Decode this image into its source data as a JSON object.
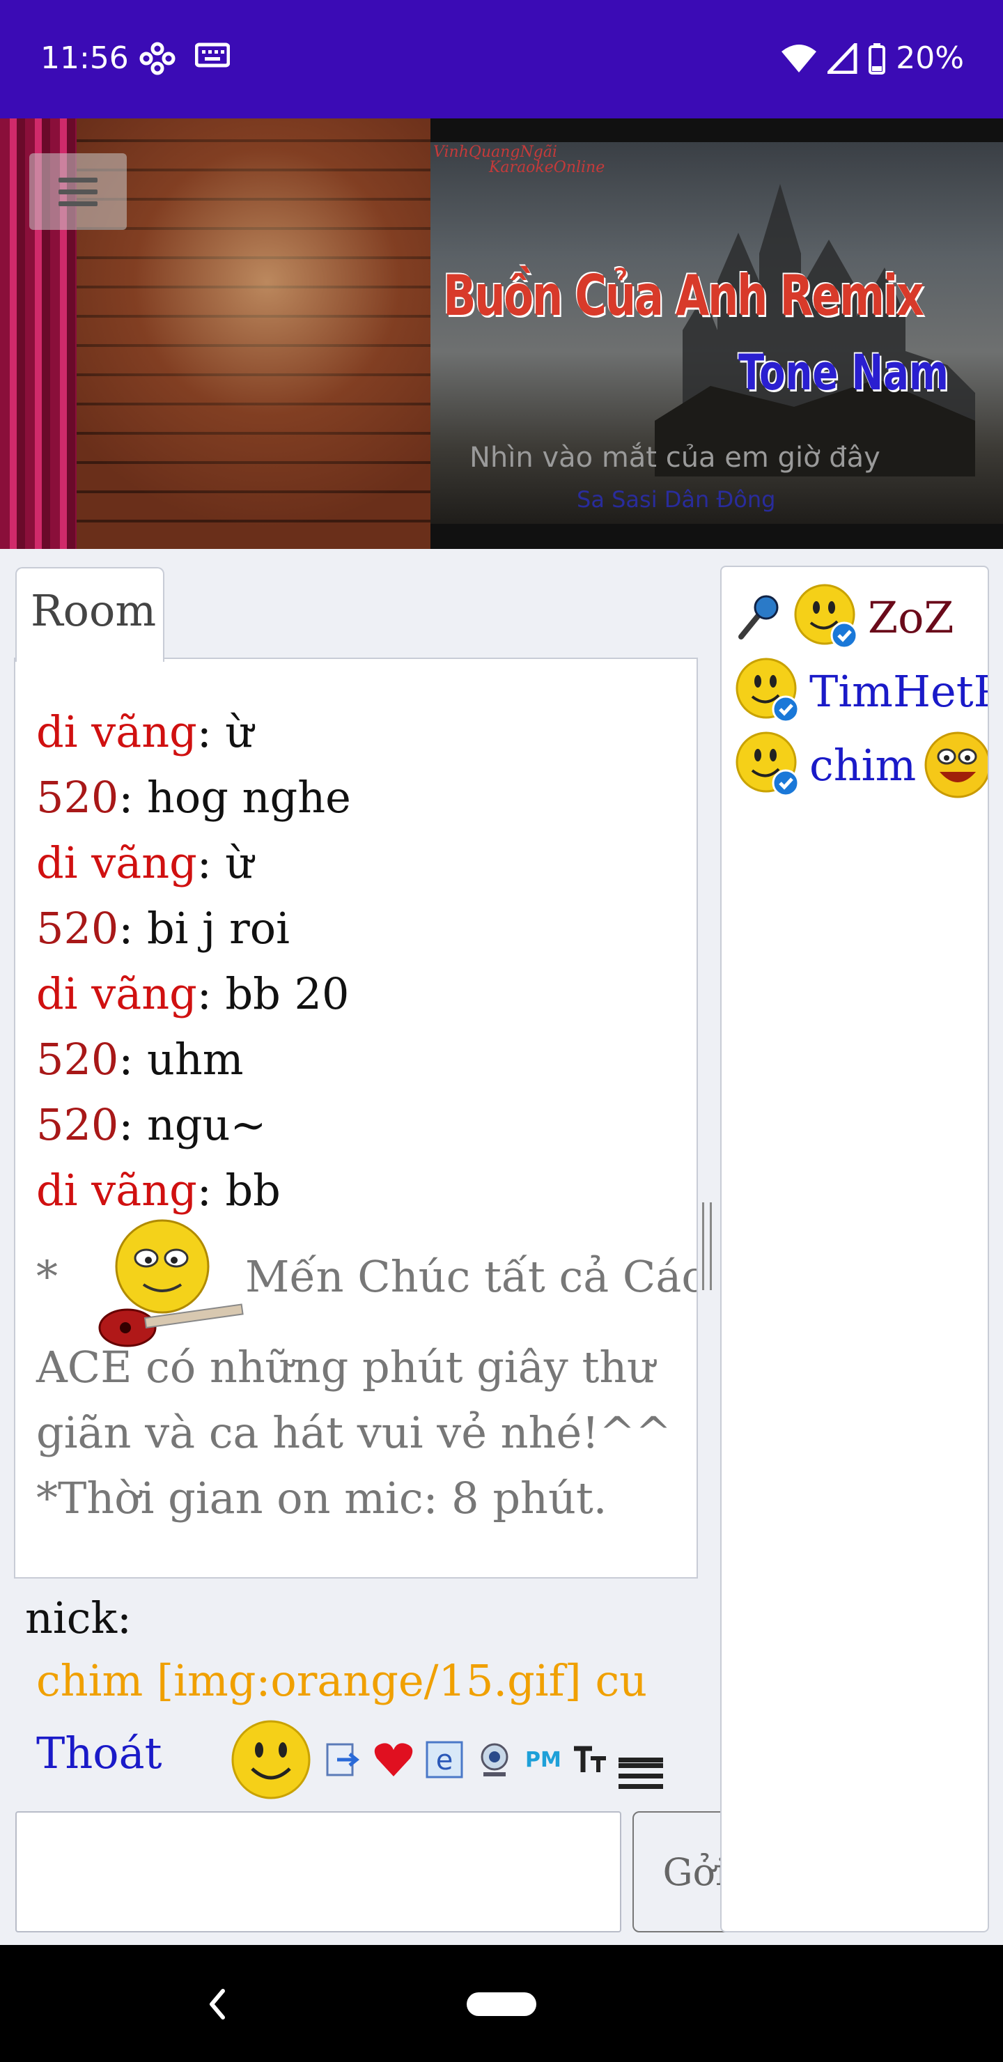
{
  "status_bar": {
    "time": "11:56",
    "battery": "20%"
  },
  "banner": {
    "logo_line1": "VinhQuangNgãi",
    "logo_line2": "KaraokeOnline",
    "song_title": "Buồn Của Anh Remix",
    "tone": "Tone Nam",
    "lyric": "Nhìn vào mắt của em giờ đây",
    "lyric_sub": "Sa Sasi Dân Đông"
  },
  "chat": {
    "tab_label": "Room",
    "messages": [
      {
        "nick": "di vãng",
        "text": ": ừ",
        "nick_color": "#d01010"
      },
      {
        "nick": "520",
        "text": ": hog nghe",
        "nick_color": "#a81818"
      },
      {
        "nick": "di vãng",
        "text": ": ừ",
        "nick_color": "#d01010"
      },
      {
        "nick": "520",
        "text": ": bi j roi",
        "nick_color": "#a81818"
      },
      {
        "nick": "di vãng",
        "text": ": bb 20",
        "nick_color": "#d01010"
      },
      {
        "nick": "520",
        "text": ": uhm",
        "nick_color": "#a81818"
      },
      {
        "nick": "520",
        "text": ": ngu~",
        "nick_color": "#a81818"
      },
      {
        "nick": "di vãng",
        "text": ": bb",
        "nick_color": "#d01010"
      }
    ],
    "topic_star": "*",
    "topic_line1": "Mến Chúc tất cả Các",
    "topic_line2": "ACE có những phút giây thư",
    "topic_line3": "giãn và ca hát vui vẻ nhé!^^",
    "topic_line4": "*Thời gian on mic: 8 phút."
  },
  "compose": {
    "nick_label": "nick:",
    "nick_value": "chim [img:orange/15.gif] cu",
    "logout_label": "Thoát",
    "toolbar_pm": "PM",
    "toolbar_tt": "TT",
    "send_label": "Gởi",
    "input_value": ""
  },
  "users": [
    {
      "name": "ZoZ",
      "mic": true
    },
    {
      "name": "TimHetP",
      "mic": false
    },
    {
      "name": "chim",
      "mic": false
    }
  ],
  "colors": {
    "status_bar": "#3b0bb5",
    "nick_red": "#d01010",
    "nick_dark": "#a81818",
    "link_blue": "#1a1ac8",
    "nick_orange": "#f0a000"
  }
}
